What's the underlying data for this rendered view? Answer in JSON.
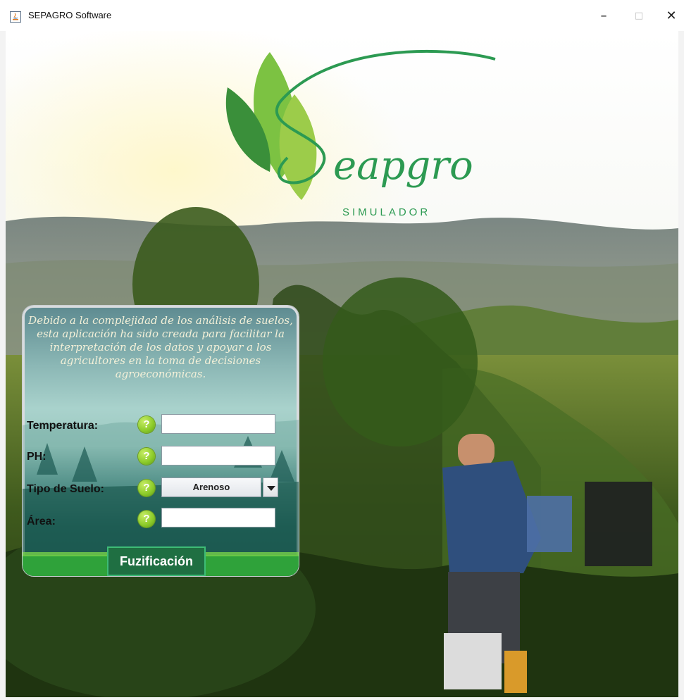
{
  "window": {
    "title": "SEPAGRO Software",
    "minimize_label": "–",
    "maximize_label": "□",
    "close_label": "✕"
  },
  "logo": {
    "brand": "eapgro",
    "tagline": "SIMULADOR"
  },
  "intro": {
    "text": "Debido a la complejidad de los análisis de suelos, esta aplicación ha sido creada para facilitar la interpretación de los datos y apoyar a los agricultores en la toma de decisiones agroeconómicas."
  },
  "form": {
    "temperatura_label": "Temperatura:",
    "ph_label": "PH:",
    "tipo_suelo_label": "Tipo de Suelo:",
    "area_label": "Área:",
    "help_symbol": "?",
    "temperatura_value": "",
    "ph_value": "",
    "area_value": "",
    "tipo_suelo_selected": "Arenoso"
  },
  "actions": {
    "fuzzify_label": "Fuzificación"
  },
  "colors": {
    "brand_green": "#1f6f42",
    "help_green": "#8fcd2c",
    "intro_text": "#f3f0d8"
  }
}
